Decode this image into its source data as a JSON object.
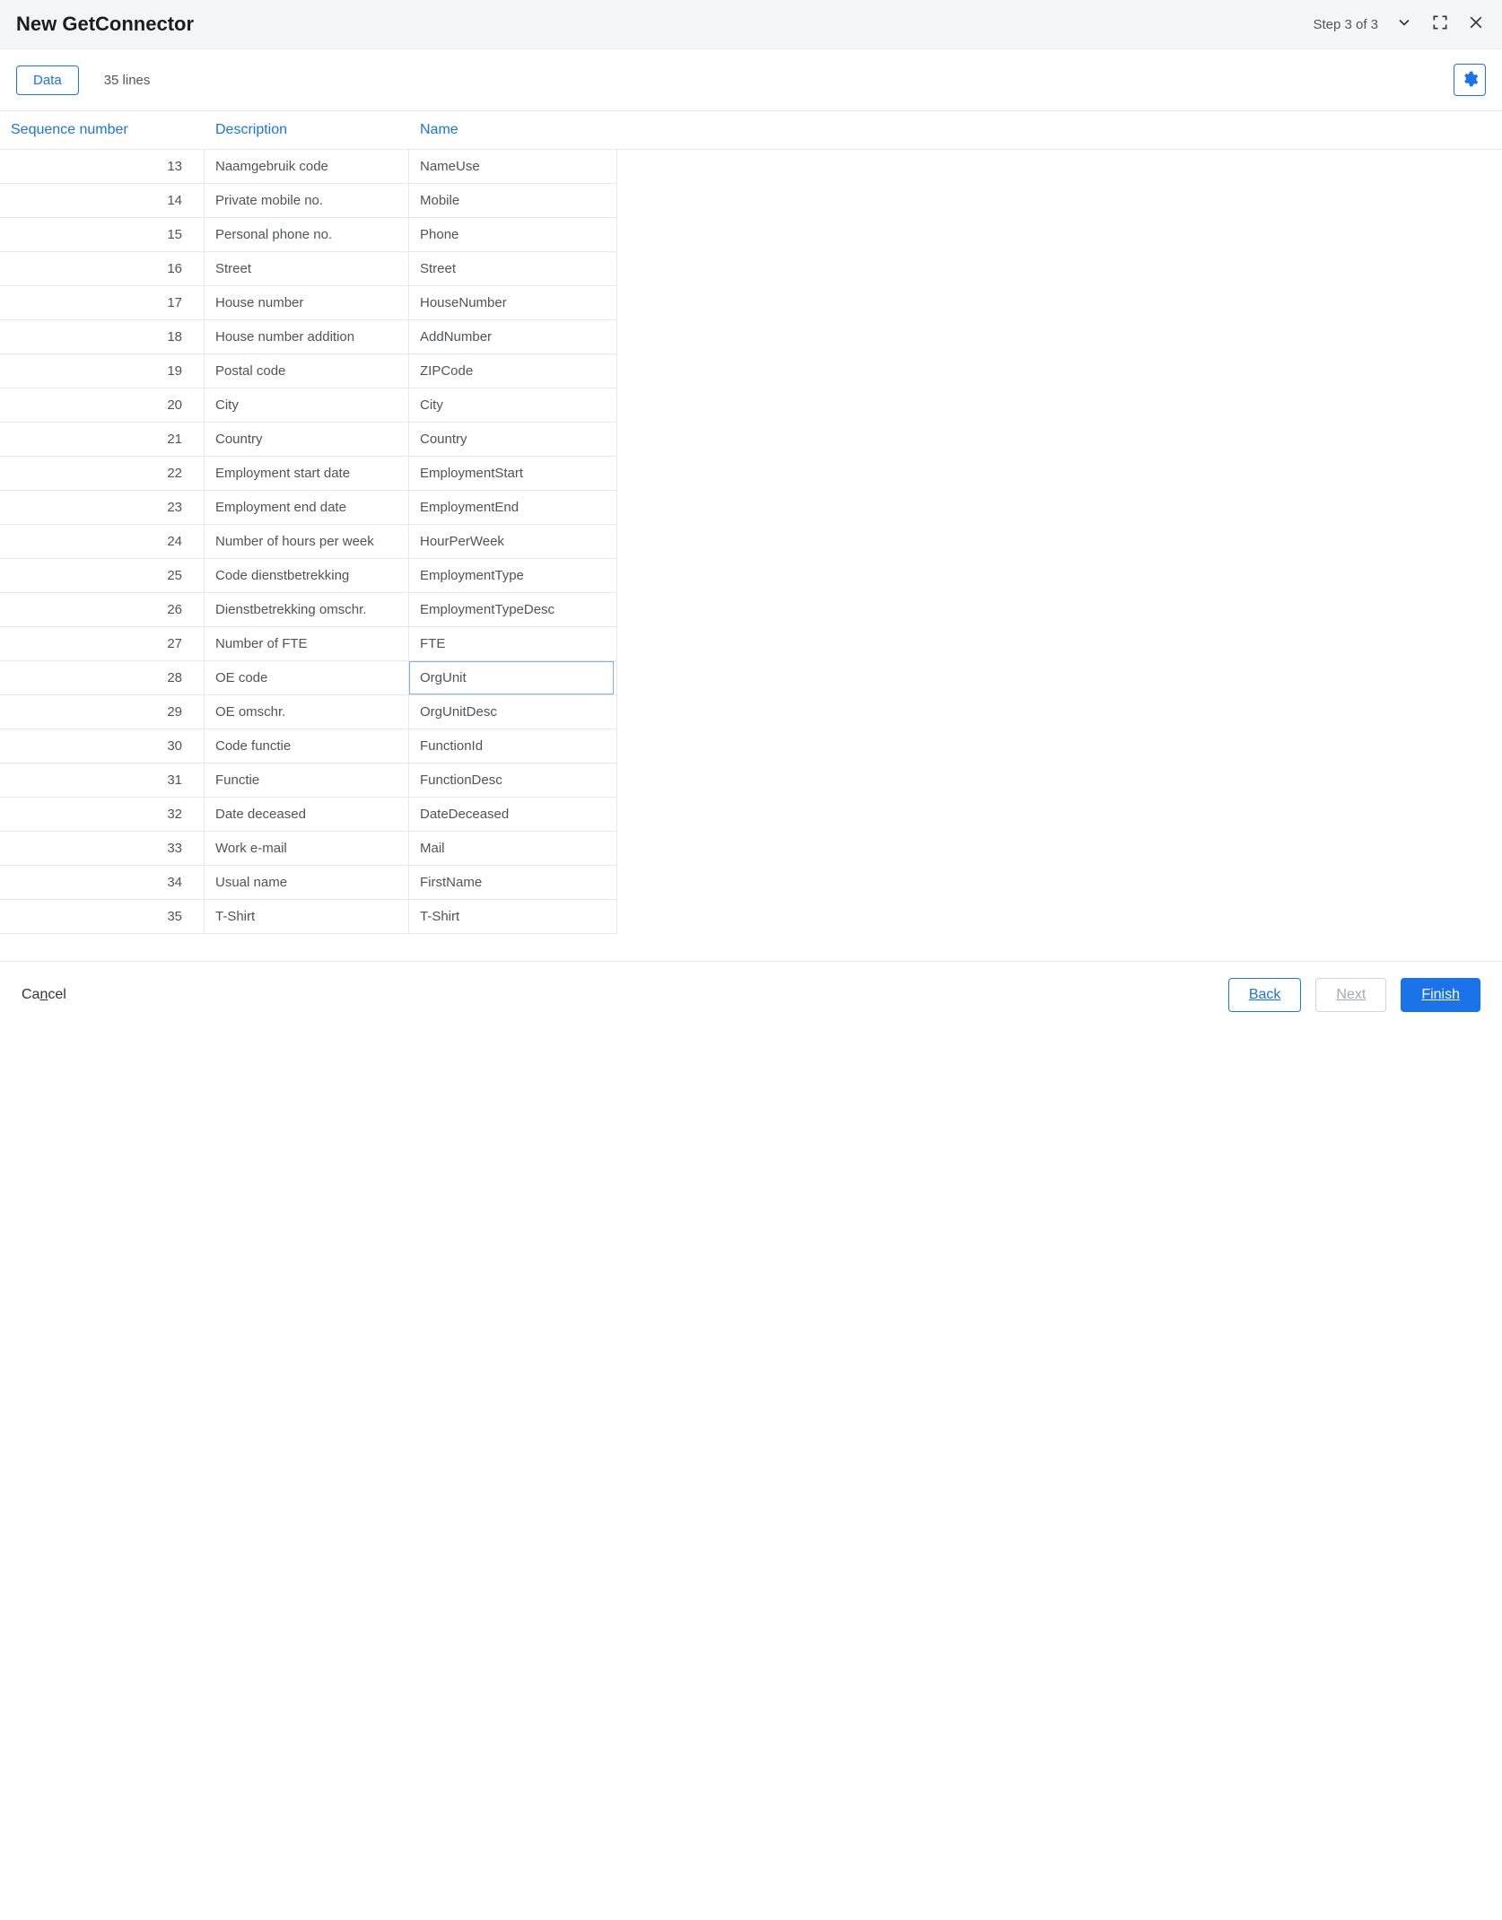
{
  "header": {
    "title": "New GetConnector",
    "step": "Step 3 of 3"
  },
  "toolbar": {
    "data_label": "Data",
    "lines_label": "35 lines"
  },
  "table": {
    "headers": {
      "seq": "Sequence number",
      "desc": "Description",
      "name": "Name"
    },
    "selected_row_index": 15,
    "rows": [
      {
        "seq": "13",
        "desc": "Naamgebruik code",
        "name": "NameUse"
      },
      {
        "seq": "14",
        "desc": "Private mobile no.",
        "name": "Mobile"
      },
      {
        "seq": "15",
        "desc": "Personal phone no.",
        "name": "Phone"
      },
      {
        "seq": "16",
        "desc": "Street",
        "name": "Street"
      },
      {
        "seq": "17",
        "desc": "House number",
        "name": "HouseNumber"
      },
      {
        "seq": "18",
        "desc": "House number addition",
        "name": "AddNumber"
      },
      {
        "seq": "19",
        "desc": "Postal code",
        "name": "ZIPCode"
      },
      {
        "seq": "20",
        "desc": "City",
        "name": "City"
      },
      {
        "seq": "21",
        "desc": "Country",
        "name": "Country"
      },
      {
        "seq": "22",
        "desc": "Employment start date",
        "name": "EmploymentStart"
      },
      {
        "seq": "23",
        "desc": "Employment end date",
        "name": "EmploymentEnd"
      },
      {
        "seq": "24",
        "desc": "Number of hours per week",
        "name": "HourPerWeek"
      },
      {
        "seq": "25",
        "desc": "Code dienstbetrekking",
        "name": "EmploymentType"
      },
      {
        "seq": "26",
        "desc": "Dienstbetrekking omschr.",
        "name": "EmploymentTypeDesc"
      },
      {
        "seq": "27",
        "desc": "Number of FTE",
        "name": "FTE"
      },
      {
        "seq": "28",
        "desc": "OE code",
        "name": "OrgUnit"
      },
      {
        "seq": "29",
        "desc": "OE omschr.",
        "name": "OrgUnitDesc"
      },
      {
        "seq": "30",
        "desc": "Code functie",
        "name": "FunctionId"
      },
      {
        "seq": "31",
        "desc": "Functie",
        "name": "FunctionDesc"
      },
      {
        "seq": "32",
        "desc": "Date deceased",
        "name": "DateDeceased"
      },
      {
        "seq": "33",
        "desc": "Work e-mail",
        "name": "Mail"
      },
      {
        "seq": "34",
        "desc": "Usual name",
        "name": "FirstName"
      },
      {
        "seq": "35",
        "desc": "T-Shirt",
        "name": "T-Shirt"
      }
    ]
  },
  "footer": {
    "cancel": "Cancel",
    "back": "Back",
    "next": "Next",
    "finish": "Finish"
  }
}
